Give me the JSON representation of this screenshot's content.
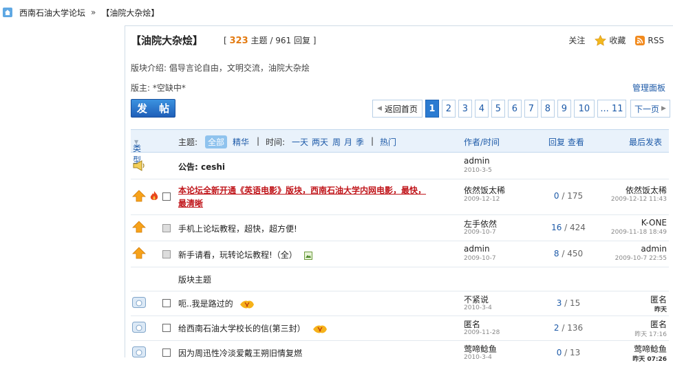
{
  "breadcrumb": {
    "home": "西南石油大学论坛",
    "separator": "»",
    "current": "【油院大杂烩】"
  },
  "header": {
    "title": "【油院大杂烩】",
    "stats_open": "[",
    "topics_count": "323",
    "topics_label": "主题",
    "slash": "/",
    "replies_count": "961",
    "replies_label": "回复",
    "stats_close": "]",
    "follow": "关注",
    "favorite": "收藏",
    "rss": "RSS",
    "intro_label": "版块介绍:",
    "intro_text": "倡导言论自由，文明交流，油院大杂烩",
    "moderator_label": "版主:",
    "moderator_value": "*空缺中*",
    "manage": "管理面板"
  },
  "toolbar": {
    "post_button": "发 帖"
  },
  "pager": {
    "back": "返回首页",
    "pages": [
      "1",
      "2",
      "3",
      "4",
      "5",
      "6",
      "7",
      "8",
      "9",
      "10",
      "... 11"
    ],
    "current": "1",
    "next": "下一页"
  },
  "table_header": {
    "type": "类型",
    "topic_label": "主题:",
    "all": "全部",
    "digest": "精华",
    "time_label": "时间:",
    "day": "一天",
    "two_days": "两天",
    "week": "周",
    "month": "月",
    "season": "季",
    "hot": "热门",
    "author_time": "作者/时间",
    "reply_view": "回复 查看",
    "last_post": "最后发表"
  },
  "announcement": {
    "title": "公告: ceshi",
    "author": "admin",
    "date": "2010-3-5"
  },
  "rows": [
    {
      "title": "本论坛全新开通《英语电影》版块，西南石油大学内网电影，最快，",
      "title2": "最清晰",
      "author": "依然饭太稀",
      "date": "2009-12-12",
      "replies": "0",
      "views": "175",
      "last_author": "依然饭太稀",
      "last_date": "2009-12-12 11:43"
    },
    {
      "title": "手机上论坛教程，超快，超方便!",
      "author": "左手依然",
      "date": "2009-10-7",
      "replies": "16",
      "views": "424",
      "last_author": "K-ONE",
      "last_date": "2009-11-18 18:49"
    },
    {
      "title": "新手请看，玩转论坛教程!（全）",
      "author": "admin",
      "date": "2009-10-7",
      "replies": "8",
      "views": "450",
      "last_author": "admin",
      "last_date": "2009-10-7 22:55"
    },
    {
      "section": "版块主题"
    },
    {
      "title": "呃..我是路过的",
      "author": "不紧说",
      "date": "2010-3-4",
      "replies": "3",
      "views": "15",
      "last_author": "匿名",
      "last_date": "昨天"
    },
    {
      "title": "给西南石油大学校长的信(第三封）",
      "author": "匿名",
      "date": "2009-11-28",
      "replies": "2",
      "views": "136",
      "last_author": "匿名",
      "last_date": "昨天 17:16"
    },
    {
      "title": "因为周迅性冷淡爱戴王朔旧情复燃",
      "author": "莺啼鲶鱼",
      "date": "2010-3-4",
      "replies": "0",
      "views": "13",
      "last_author": "莺啼鲶鱼",
      "last_date": "昨天 07:26"
    }
  ],
  "colors": {
    "link": "#1d5aa8",
    "accent": "#e37a10",
    "red_title": "#c0161b",
    "header_bg": "#e9f2fb"
  }
}
